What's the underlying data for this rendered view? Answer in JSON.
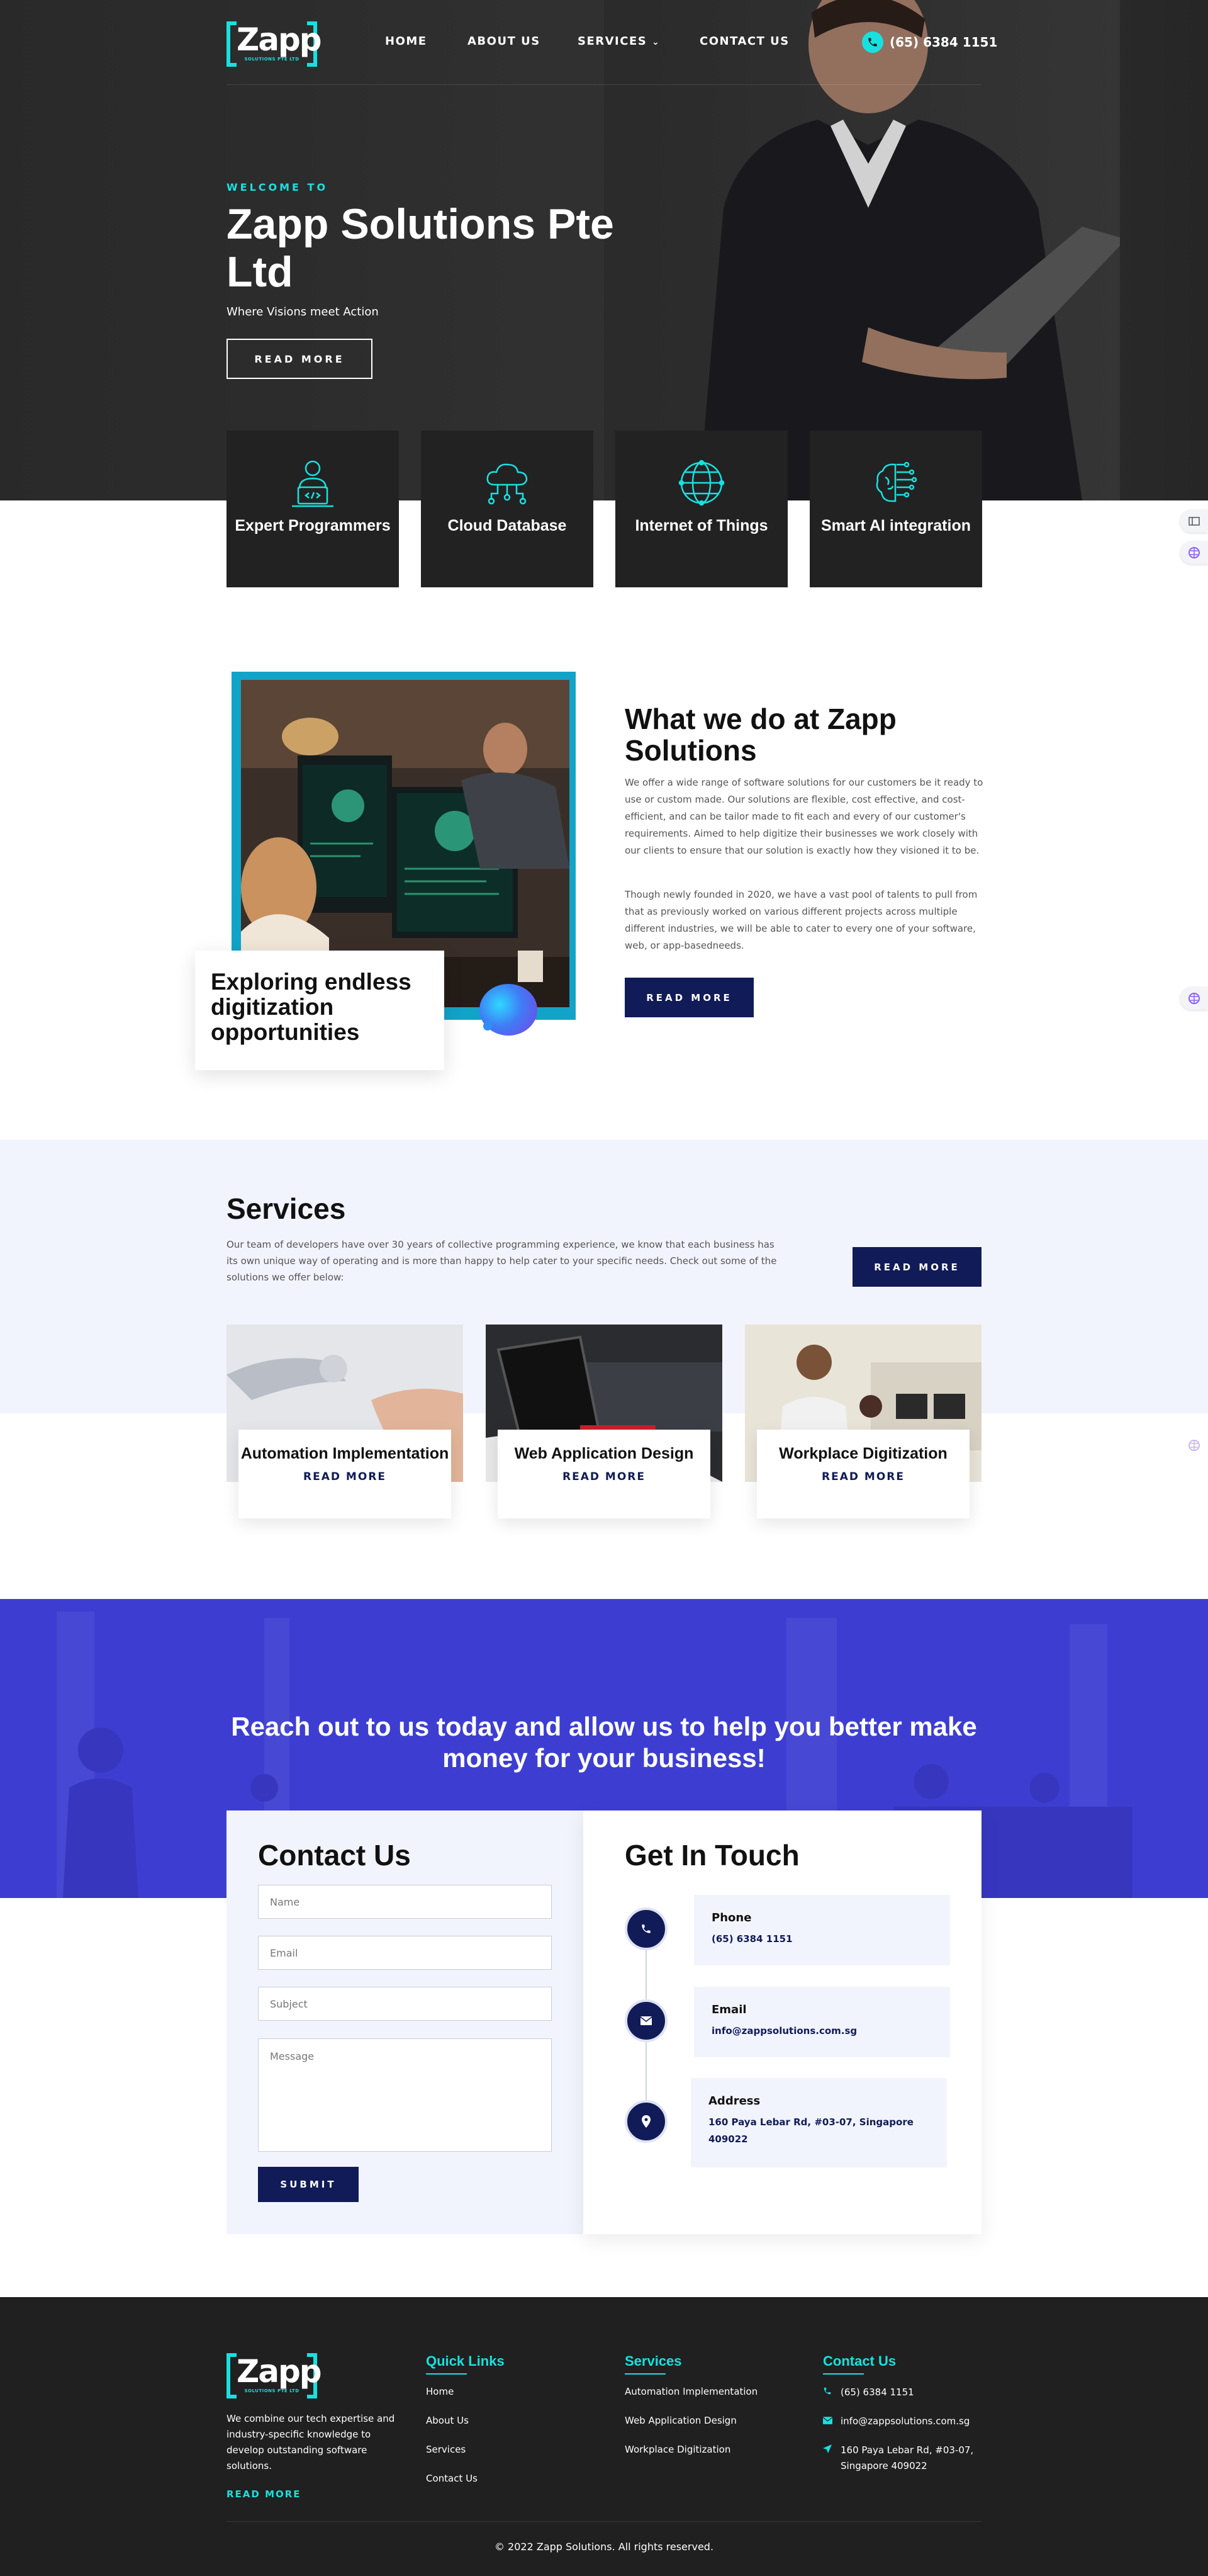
{
  "brand": {
    "name": "Zapp",
    "tagline": "SOLUTIONS PTE LTD",
    "accent": "#19e0e0",
    "navy": "#111b57",
    "cta_blue": "#3d3ed1"
  },
  "nav": {
    "items": [
      {
        "label": "HOME"
      },
      {
        "label": "ABOUT US"
      },
      {
        "label": "SERVICES"
      },
      {
        "label": "CONTACT US"
      }
    ],
    "services_caret": "⌄",
    "phone": "(65) 6384 1151"
  },
  "hero": {
    "kicker": "WELCOME TO",
    "title": "Zapp Solutions Pte Ltd",
    "subtitle": "Where Visions meet Action",
    "button": "READ MORE"
  },
  "features": [
    {
      "label": "Expert Programmers",
      "icon": "programmer-icon"
    },
    {
      "label": "Cloud Database",
      "icon": "cloud-database-icon"
    },
    {
      "label": "Internet of Things",
      "icon": "iot-globe-icon"
    },
    {
      "label": "Smart AI integration",
      "icon": "ai-brain-icon"
    }
  ],
  "about": {
    "card_text": "Exploring endless digitization opportunities",
    "title": "What we do at Zapp Solutions",
    "p1": "We offer a wide range of software solutions for our customers be it ready to use or custom made. Our solutions are flexible, cost effective, and cost-efficient, and can be tailor made to fit each and every of our customer's requirements. Aimed to help digitize their businesses we work closely with our clients to ensure that our solution is exactly how they visioned it to be.",
    "p2": "Though newly founded in 2020, we have a vast pool of talents to pull from that as previously worked on various different projects across multiple different industries, we will be able to cater to every one of your software, web, or app-basedneeds.",
    "button": "READ MORE"
  },
  "services": {
    "title": "Services",
    "description": "Our team of developers have over 30 years of collective programming experience, we know that each business has its own unique way of operating and is more than happy to help cater to your specific needs. Check out some of the solutions we offer below:",
    "button": "READ MORE",
    "items": [
      {
        "title": "Automation Implementation",
        "link": "READ MORE"
      },
      {
        "title": "Web Application Design",
        "link": "READ MORE"
      },
      {
        "title": "Workplace Digitization",
        "link": "READ MORE"
      }
    ]
  },
  "cta": {
    "title": "Reach out to us today and allow us to help you better make money for your business!"
  },
  "contact": {
    "title": "Contact Us",
    "name_ph": "Name",
    "email_ph": "Email",
    "subject_ph": "Subject",
    "message_ph": "Message",
    "submit": "SUBMIT"
  },
  "touch": {
    "title": "Get In Touch",
    "items": [
      {
        "label": "Phone",
        "value": "(65) 6384 1151"
      },
      {
        "label": "Email",
        "value": "info@zappsolutions.com.sg"
      },
      {
        "label": "Address",
        "value": "160 Paya Lebar Rd, #03-07, Singapore 409022"
      }
    ]
  },
  "footer": {
    "description": "We combine our tech expertise and industry-specific knowledge to develop outstanding software solutions.",
    "read_more": "READ MORE",
    "quick_links_title": "Quick Links",
    "quick_links": [
      "Home",
      "About Us",
      "Services",
      "Contact Us"
    ],
    "services_title": "Services",
    "services": [
      "Automation Implementation",
      "Web Application Design",
      "Workplace Digitization"
    ],
    "contact_title": "Contact Us",
    "phone": "(65) 6384 1151",
    "email": "info@zappsolutions.com.sg",
    "address": "160 Paya Lebar Rd, #03-07, Singapore 409022",
    "copyright": "© 2022 Zapp Solutions. All rights reserved."
  }
}
